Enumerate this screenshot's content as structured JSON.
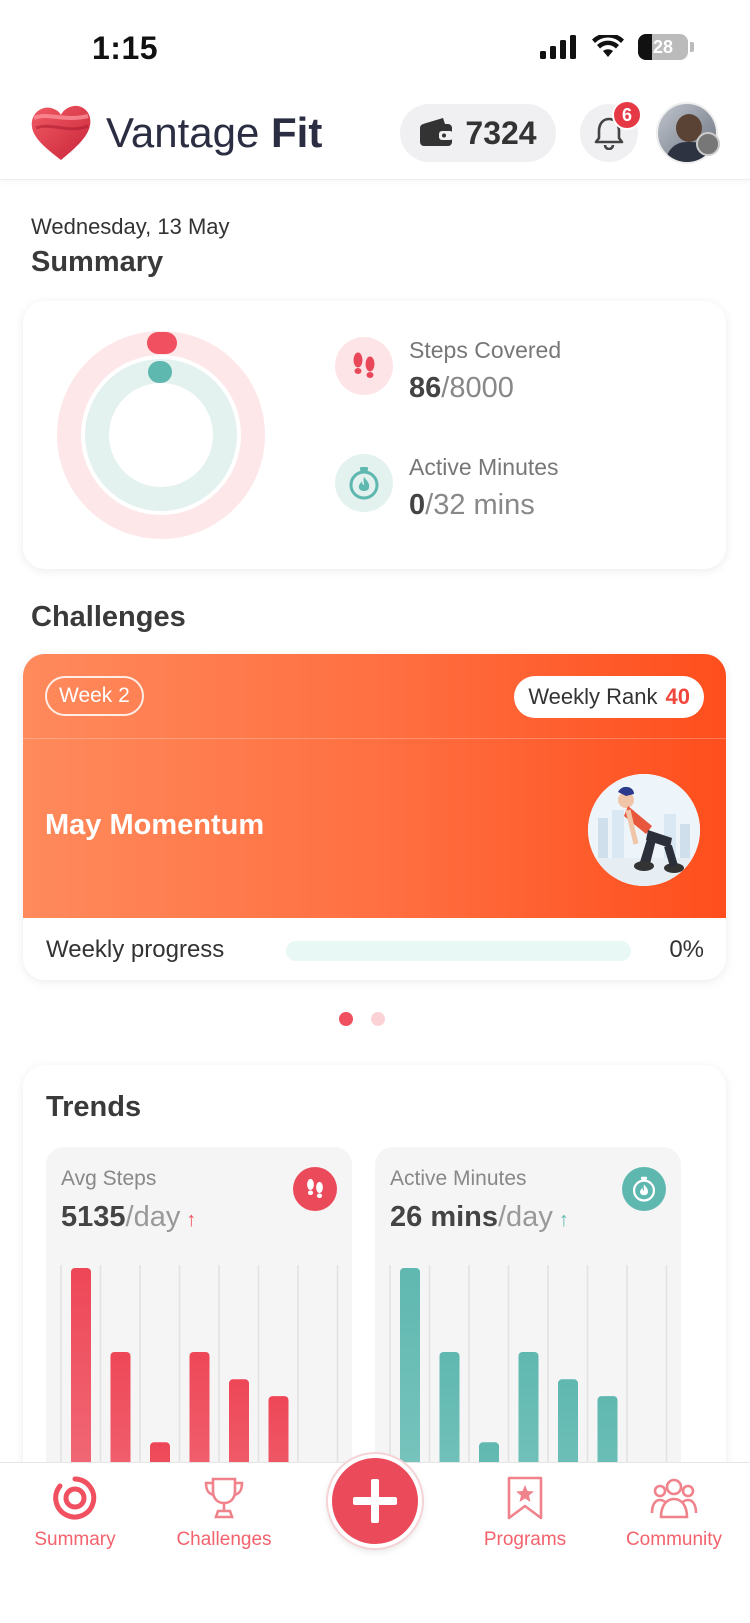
{
  "status_bar": {
    "time": "1:15",
    "battery": "28"
  },
  "header": {
    "app_name_part1": "Vantage",
    "app_name_part2": "Fit",
    "coins": "7324",
    "notifications_count": "6"
  },
  "summary": {
    "date": "Wednesday, 13 May",
    "title": "Summary",
    "steps_label": "Steps Covered",
    "steps_current": "86",
    "steps_goal": "/8000",
    "active_label": "Active Minutes",
    "active_current": "0",
    "active_goal": "/32 mins"
  },
  "challenges": {
    "title": "Challenges",
    "week": "Week 2",
    "rank_label": "Weekly Rank",
    "rank_value": "40",
    "name": "May Momentum",
    "progress_label": "Weekly progress",
    "progress_percent_text": "0%",
    "progress_fraction": 0,
    "pager_active": 0,
    "pager_count": 2
  },
  "trends": {
    "title": "Trends",
    "steps": {
      "label": "Avg Steps",
      "value": "5135",
      "unit": "/day",
      "arrow": "↑",
      "bars_relative": [
        1.0,
        0.6,
        0.17,
        0.6,
        0.47,
        0.39,
        0
      ]
    },
    "active": {
      "label": "Active Minutes",
      "value": "26 mins",
      "unit": "/day",
      "arrow": "↑",
      "bars_relative": [
        1.0,
        0.6,
        0.17,
        0.6,
        0.47,
        0.39,
        0
      ]
    }
  },
  "nav": {
    "summary": "Summary",
    "challenges": "Challenges",
    "programs": "Programs",
    "community": "Community"
  },
  "colors": {
    "accent_red": "#f0505f",
    "accent_teal": "#5fb8b0",
    "challenge_orange": "#ff6d3f"
  }
}
